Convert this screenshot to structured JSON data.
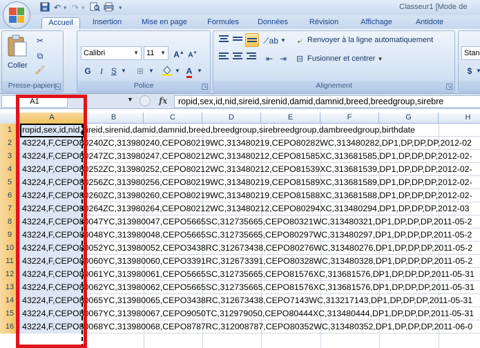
{
  "window": {
    "title": "Classeur1  [Mode de"
  },
  "quick_access": [
    "save-icon",
    "undo-icon",
    "redo-icon",
    "print-preview-icon",
    "print-icon",
    "customize-icon"
  ],
  "tabs": [
    {
      "label": "Accueil",
      "active": true
    },
    {
      "label": "Insertion",
      "active": false
    },
    {
      "label": "Mise en page",
      "active": false
    },
    {
      "label": "Formules",
      "active": false
    },
    {
      "label": "Données",
      "active": false
    },
    {
      "label": "Révision",
      "active": false
    },
    {
      "label": "Affichage",
      "active": false
    },
    {
      "label": "Antidote",
      "active": false
    }
  ],
  "ribbon": {
    "clipboard": {
      "paste_label": "Coller",
      "group_label": "Presse-papiers"
    },
    "font": {
      "family": "Calibri",
      "size": "11",
      "bold": "G",
      "italic": "I",
      "underline": "S",
      "group_label": "Police"
    },
    "alignment": {
      "wrap_label": "Renvoyer à la ligne automatiquement",
      "merge_label": "Fusionner et centrer",
      "group_label": "Alignement"
    },
    "number": {
      "format": "Stand",
      "currency": "$"
    }
  },
  "formula_bar": {
    "name_box": "A1",
    "fx": "fx",
    "content": "ropid,sex,id,nid,sireid,sirenid,damid,damnid,breed,breedgroup,sirebre"
  },
  "grid": {
    "columns": [
      "A",
      "B",
      "C",
      "D",
      "E",
      "F",
      "G",
      "H"
    ],
    "selected_column": "A",
    "rows": [
      {
        "n": "1",
        "text": "ropid,sex,id,nid,sireid,sirenid,damid,damnid,breed,breedgroup,sirebreedgroup,dambreedgroup,birthdate"
      },
      {
        "n": "2",
        "text": "43224,F,CEPO80240ZC,313980240,CEPO80219WC,313480219,CEPO80282WC,313480282,DP1,DP,DP,DP,2012-02"
      },
      {
        "n": "3",
        "text": "43224,F,CEPO80247ZC,313980247,CEPO80212WC,313480212,CEPO81585XC,313681585,DP1,DP,DP,DP,2012-02-"
      },
      {
        "n": "4",
        "text": "43224,F,CEPO80252ZC,313980252,CEPO80212WC,313480212,CEPO81539XC,313681539,DP1,DP,DP,DP,2012-02-"
      },
      {
        "n": "5",
        "text": "43224,F,CEPO80256ZC,313980256,CEPO80219WC,313480219,CEPO81589XC,313681589,DP1,DP,DP,DP,2012-02-"
      },
      {
        "n": "6",
        "text": "43224,F,CEPO80260ZC,313980260,CEPO80219WC,313480219,CEPO81588XC,313681588,DP1,DP,DP,DP,2012-02-"
      },
      {
        "n": "7",
        "text": "43224,F,CEPO80264ZC,313980264,CEPO80212WC,313480212,CEPO80294XC,313480294,DP1,DP,DP,DP,2012-03"
      },
      {
        "n": "8",
        "text": "43224,F,CEPO80047YC,313980047,CEPO5665SC,312735665,CEPO80321WC,313480321,DP1,DP,DP,DP,2011-05-2"
      },
      {
        "n": "9",
        "text": "43224,F,CEPO80048YC,313980048,CEPO5665SC,312735665,CEPO80297WC,313480297,DP1,DP,DP,DP,2011-05-2"
      },
      {
        "n": "10",
        "text": "43224,F,CEPO80052YC,313980052,CEPO3438RC,312673438,CEPO80276WC,313480276,DP1,DP,DP,DP,2011-05-2"
      },
      {
        "n": "11",
        "text": "43224,F,CEPO80060YC,313980060,CEPO3391RC,312673391,CEPO80328WC,313480328,DP1,DP,DP,DP,2011-05-2"
      },
      {
        "n": "12",
        "text": "43224,F,CEPO80061YC,313980061,CEPO5665SC,312735665,CEPO81576XC,313681576,DP1,DP,DP,DP,2011-05-31"
      },
      {
        "n": "13",
        "text": "43224,F,CEPO80062YC,313980062,CEPO5665SC,312735665,CEPO81576XC,313681576,DP1,DP,DP,DP,2011-05-31"
      },
      {
        "n": "14",
        "text": "43224,F,CEPO80065YC,313980065,CEPO3438RC,312673438,CEPO7143WC,313217143,DP1,DP,DP,DP,2011-05-31"
      },
      {
        "n": "15",
        "text": "43224,F,CEPO80067YC,313980067,CEPO9050TC,312979050,CEPO80444XC,313480444,DP1,DP,DP,DP,2011-05-31"
      },
      {
        "n": "16",
        "text": "43224,F,CEPO80068YC,313980068,CEPO8787RC,312008787,CEPO80352WC,313480352,DP1,DP,DP,DP,2011-06-0"
      }
    ]
  },
  "colors": {
    "annotation_box": "#e0141b",
    "selected_header": "#f1c15f"
  }
}
